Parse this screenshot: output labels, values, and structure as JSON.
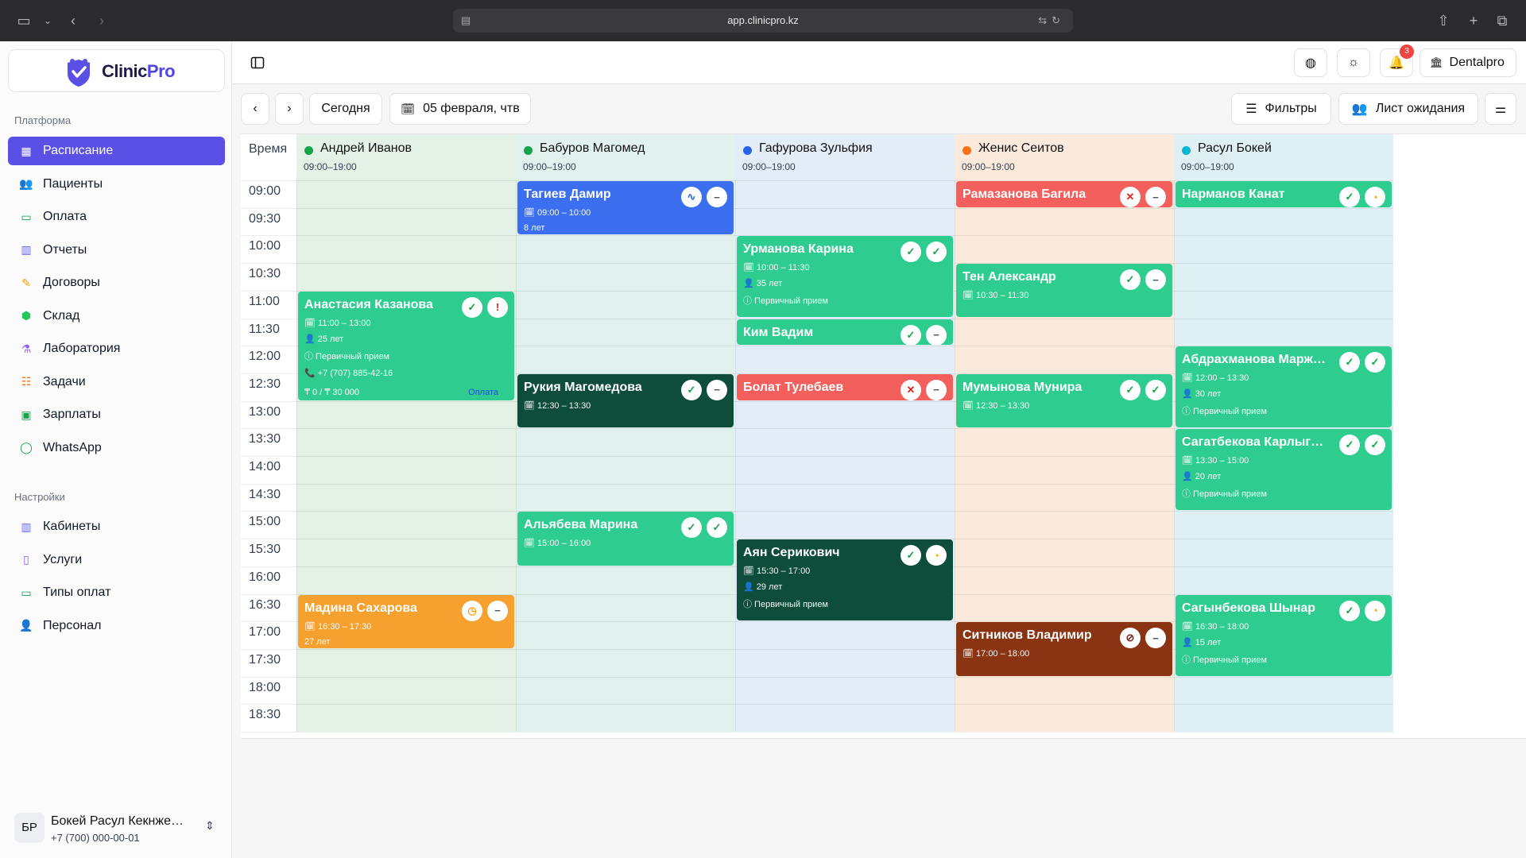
{
  "browser": {
    "url": "app.clinicpro.kz"
  },
  "app": {
    "logo_text_1": "Clinic",
    "logo_text_2": "Pro",
    "workspace": "Dentalpro",
    "notifications_count": "3"
  },
  "sidebar": {
    "platform_title": "Платформа",
    "platform_items": [
      {
        "label": "Расписание",
        "icon": "calendar-icon",
        "active": true
      },
      {
        "label": "Пациенты",
        "icon": "users-icon"
      },
      {
        "label": "Оплата",
        "icon": "card-icon"
      },
      {
        "label": "Отчеты",
        "icon": "chart-icon"
      },
      {
        "label": "Договоры",
        "icon": "contract-icon"
      },
      {
        "label": "Склад",
        "icon": "box-icon"
      },
      {
        "label": "Лаборатория",
        "icon": "flask-icon"
      },
      {
        "label": "Задачи",
        "icon": "tasks-icon"
      },
      {
        "label": "Зарплаты",
        "icon": "money-icon"
      },
      {
        "label": "WhatsApp",
        "icon": "whatsapp-icon"
      }
    ],
    "settings_title": "Настройки",
    "settings_items": [
      {
        "label": "Кабинеты",
        "icon": "map-icon"
      },
      {
        "label": "Услуги",
        "icon": "book-icon"
      },
      {
        "label": "Типы оплат",
        "icon": "card-icon"
      },
      {
        "label": "Персонал",
        "icon": "staff-icon"
      }
    ],
    "user": {
      "initials": "БР",
      "name": "Бокей Расул Кекнже…",
      "phone": "+7 (700) 000-00-01"
    }
  },
  "toolbar": {
    "today_label": "Сегодня",
    "date_label": "05 февраля, чтв",
    "filters_label": "Фильтры",
    "waitlist_label": "Лист ожидания"
  },
  "calendar": {
    "time_header": "Время",
    "times": [
      "09:00",
      "09:30",
      "10:00",
      "10:30",
      "11:00",
      "11:30",
      "12:00",
      "12:30",
      "13:00",
      "13:30",
      "14:00",
      "14:30",
      "15:00",
      "15:30",
      "16:00",
      "16:30",
      "17:00",
      "17:30",
      "18:00",
      "18:30"
    ],
    "doctors": [
      {
        "name": "Андрей Иванов",
        "hours": "09:00–19:00",
        "dot": "#16a34a",
        "bg": "#e3f1e7"
      },
      {
        "name": "Бабуров Магомед",
        "hours": "09:00–19:00",
        "dot": "#16a34a",
        "bg": "#e0f1ee"
      },
      {
        "name": "Гафурова Зульфия",
        "hours": "09:00–19:00",
        "dot": "#2563eb",
        "bg": "#e3edf7"
      },
      {
        "name": "Женис Сеитов",
        "hours": "09:00–19:00",
        "dot": "#f97316",
        "bg": "#fbe9dc"
      },
      {
        "name": "Расул Бокей",
        "hours": "09:00–19:00",
        "dot": "#06b6d4",
        "bg": "#dff0f5"
      }
    ],
    "appointments": [
      {
        "col": 0,
        "start": 11,
        "end": 13,
        "name": "Анастасия Казанова",
        "color": "#2ecc8f",
        "lines": [
          "🗓 11:00 – 13:00",
          "👤 25 лет",
          "ⓘ Первичный прием",
          "📞 +7 (707) 885-42-16"
        ],
        "pay": "₸ 0 / ₸ 30 000",
        "pay_link": "Оплата",
        "icons": [
          {
            "g": "✓",
            "c": "#16a34a"
          },
          {
            "g": "!",
            "c": "#dc2626"
          }
        ]
      },
      {
        "col": 0,
        "start": 16.5,
        "end": 17.5,
        "name": "Мадина Сахарова",
        "color": "#f5a02f",
        "lines": [
          "🗓 16:30 – 17:30",
          "27 лет"
        ],
        "icons": [
          {
            "g": "◷",
            "c": "#f59e0b"
          },
          {
            "g": "−",
            "c": "#4b5563"
          }
        ]
      },
      {
        "col": 1,
        "start": 9,
        "end": 10,
        "name": "Тагиев Дамир",
        "color": "#3b6ff0",
        "lines": [
          "🗓 09:00 – 10:00",
          "8 лет"
        ],
        "icons": [
          {
            "g": "∿",
            "c": "#2563eb"
          },
          {
            "g": "−",
            "c": "#4b5563"
          }
        ]
      },
      {
        "col": 1,
        "start": 12.5,
        "end": 13.5,
        "name": "Рукия Магомедова",
        "color": "#0e4d3b",
        "lines": [
          "🗓 12:30 – 13:30"
        ],
        "icons": [
          {
            "g": "✓",
            "c": "#16a34a"
          },
          {
            "g": "−",
            "c": "#4b5563"
          }
        ]
      },
      {
        "col": 1,
        "start": 15,
        "end": 16,
        "name": "Альябева Марина",
        "color": "#2ecc8f",
        "lines": [
          "🗓 15:00 – 16:00"
        ],
        "icons": [
          {
            "g": "✓",
            "c": "#16a34a"
          },
          {
            "g": "✓",
            "c": "#16a34a"
          }
        ]
      },
      {
        "col": 2,
        "start": 10,
        "end": 11.5,
        "name": "Урманова Карина",
        "color": "#2ecc8f",
        "lines": [
          "🗓 10:00 – 11:30",
          "👤 35 лет",
          "ⓘ Первичный прием"
        ],
        "icons": [
          {
            "g": "✓",
            "c": "#16a34a"
          },
          {
            "g": "✓",
            "c": "#16a34a"
          }
        ]
      },
      {
        "col": 2,
        "start": 11.5,
        "end": 12,
        "name": "Ким Вадим",
        "color": "#2ecc8f",
        "lines": [],
        "icons": [
          {
            "g": "✓",
            "c": "#16a34a"
          },
          {
            "g": "−",
            "c": "#4b5563"
          }
        ]
      },
      {
        "col": 2,
        "start": 12.5,
        "end": 13,
        "name": "Болат Тулебаев",
        "color": "#f25f5c",
        "lines": [],
        "icons": [
          {
            "g": "✕",
            "c": "#dc2626"
          },
          {
            "g": "−",
            "c": "#4b5563"
          }
        ]
      },
      {
        "col": 2,
        "start": 15.5,
        "end": 17,
        "name": "Аян Серикович",
        "color": "#0e4d3b",
        "lines": [
          "🗓 15:30 – 17:00",
          "👤 29 лет",
          "ⓘ Первичный прием"
        ],
        "icons": [
          {
            "g": "✓",
            "c": "#16a34a"
          },
          {
            "g": "◔",
            "c": "#f59e0b"
          }
        ]
      },
      {
        "col": 3,
        "start": 9,
        "end": 9.5,
        "name": "Рамазанова Багила",
        "color": "#f25f5c",
        "lines": [],
        "icons": [
          {
            "g": "✕",
            "c": "#dc2626"
          },
          {
            "g": "−",
            "c": "#4b5563"
          }
        ]
      },
      {
        "col": 3,
        "start": 10.5,
        "end": 11.5,
        "name": "Тен Александр",
        "color": "#2ecc8f",
        "lines": [
          "🗓 10:30 – 11:30"
        ],
        "icons": [
          {
            "g": "✓",
            "c": "#16a34a"
          },
          {
            "g": "−",
            "c": "#4b5563"
          }
        ]
      },
      {
        "col": 3,
        "start": 12.5,
        "end": 13.5,
        "name": "Мумынова Мунира",
        "color": "#2ecc8f",
        "lines": [
          "🗓 12:30 – 13:30"
        ],
        "icons": [
          {
            "g": "✓",
            "c": "#16a34a"
          },
          {
            "g": "✓",
            "c": "#16a34a"
          }
        ]
      },
      {
        "col": 3,
        "start": 17,
        "end": 18,
        "name": "Ситников Владимир",
        "color": "#8a3413",
        "lines": [
          "🗓 17:00 – 18:00"
        ],
        "icons": [
          {
            "g": "⊘",
            "c": "#7f1d1d"
          },
          {
            "g": "−",
            "c": "#4b5563"
          }
        ]
      },
      {
        "col": 4,
        "start": 9,
        "end": 9.5,
        "name": "Нарманов Канат",
        "color": "#2ecc8f",
        "lines": [],
        "icons": [
          {
            "g": "✓",
            "c": "#16a34a"
          },
          {
            "g": "◔",
            "c": "#f59e0b"
          }
        ]
      },
      {
        "col": 4,
        "start": 12,
        "end": 13.5,
        "name": "Абдрахманова Марж…",
        "color": "#2ecc8f",
        "lines": [
          "🗓 12:00 – 13:30",
          "👤 30 лет",
          "ⓘ Первичный прием"
        ],
        "icons": [
          {
            "g": "✓",
            "c": "#16a34a"
          },
          {
            "g": "✓",
            "c": "#16a34a"
          }
        ]
      },
      {
        "col": 4,
        "start": 13.5,
        "end": 15,
        "name": "Сагатбекова Карлыг…",
        "color": "#2ecc8f",
        "lines": [
          "🗓 13:30 – 15:00",
          "👤 20 лет",
          "ⓘ Первичный прием"
        ],
        "icons": [
          {
            "g": "✓",
            "c": "#16a34a"
          },
          {
            "g": "✓",
            "c": "#16a34a"
          }
        ]
      },
      {
        "col": 4,
        "start": 16.5,
        "end": 18,
        "name": "Сагынбекова Шынар",
        "color": "#2ecc8f",
        "lines": [
          "🗓 16:30 – 18:00",
          "👤 15 лет",
          "ⓘ Первичный прием"
        ],
        "icons": [
          {
            "g": "✓",
            "c": "#16a34a"
          },
          {
            "g": "◔",
            "c": "#f59e0b"
          }
        ]
      }
    ]
  }
}
